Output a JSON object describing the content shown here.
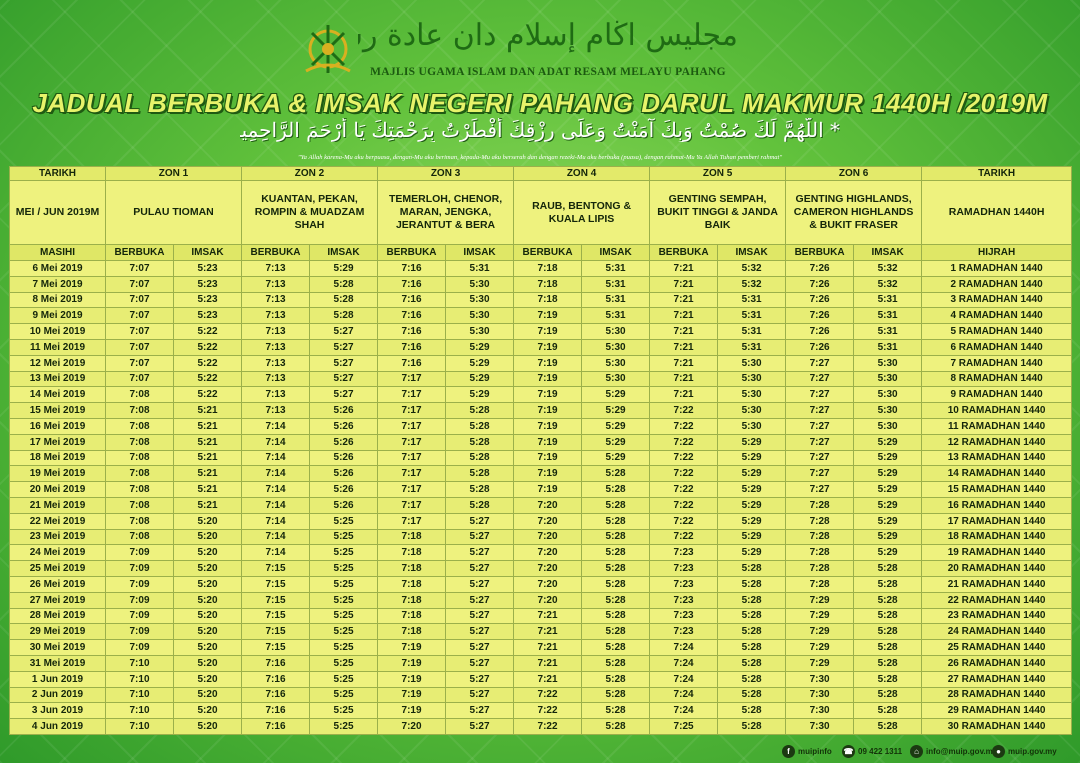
{
  "header": {
    "org_arabic": "مجليس اڬام إسلام دان عادة رسم ملايو ڤهڠ",
    "org_latin": "MAJLIS UGAMA ISLAM DAN ADAT RESAM MELAYU PAHANG",
    "main_title": "JADUAL BERBUKA & IMSAK NEGERI PAHANG DARUL MAKMUR 1440H /2019M",
    "dua_arabic": "* اللَّهُمَّ لَكَ صُمْتُ وَبِكَ آمَنْتُ وَعَلَى رِزْقِكَ أَفْطَرْتُ بِرَحْمَتِكَ يَا أَرْحَمَ الرَّاحِمِينَ *",
    "dua_translation": "\"Ya Allah karena-Mu aku berpuasa, dengan-Mu aku beriman, kepada-Mu aku berserah dan dengan rezeki-Mu aku berbuka (puasa), dengan rahmat-Mu Ya Allah Tuhan pemberi rahmat\""
  },
  "table": {
    "tarikh_label": "TARIKH",
    "tarikh_label_right": "TARIKH",
    "zones": [
      "ZON 1",
      "ZON 2",
      "ZON 3",
      "ZON 4",
      "ZON 5",
      "ZON 6"
    ],
    "month_label": "MEI / JUN 2019M",
    "zone_areas": [
      "PULAU TIOMAN",
      "KUANTAN, PEKAN, ROMPIN & MUADZAM SHAH",
      "TEMERLOH, CHENOR, MARAN, JENGKA, JERANTUT & BERA",
      "RAUB, BENTONG & KUALA LIPIS",
      "GENTING SEMPAH, BUKIT TINGGI & JANDA BAIK",
      "GENTING HIGHLANDS, CAMERON HIGHLANDS & BUKIT FRASER"
    ],
    "ramadhan_label": "RAMADHAN 1440H",
    "masihi_label": "MASIHI",
    "berbuka_label": "BERBUKA",
    "imsak_label": "IMSAK",
    "hijrah_label": "HIJRAH",
    "rows": [
      {
        "date": "6 Mei 2019",
        "t": [
          "7:07",
          "5:23",
          "7:13",
          "5:29",
          "7:16",
          "5:31",
          "7:18",
          "5:31",
          "7:21",
          "5:32",
          "7:26",
          "5:32"
        ],
        "hijri": "1 RAMADHAN 1440"
      },
      {
        "date": "7 Mei 2019",
        "t": [
          "7:07",
          "5:23",
          "7:13",
          "5:28",
          "7:16",
          "5:30",
          "7:18",
          "5:31",
          "7:21",
          "5:32",
          "7:26",
          "5:32"
        ],
        "hijri": "2 RAMADHAN 1440"
      },
      {
        "date": "8 Mei 2019",
        "t": [
          "7:07",
          "5:23",
          "7:13",
          "5:28",
          "7:16",
          "5:30",
          "7:18",
          "5:31",
          "7:21",
          "5:31",
          "7:26",
          "5:31"
        ],
        "hijri": "3 RAMADHAN 1440"
      },
      {
        "date": "9 Mei 2019",
        "t": [
          "7:07",
          "5:23",
          "7:13",
          "5:28",
          "7:16",
          "5:30",
          "7:19",
          "5:31",
          "7:21",
          "5:31",
          "7:26",
          "5:31"
        ],
        "hijri": "4 RAMADHAN 1440"
      },
      {
        "date": "10 Mei 2019",
        "t": [
          "7:07",
          "5:22",
          "7:13",
          "5:27",
          "7:16",
          "5:30",
          "7:19",
          "5:30",
          "7:21",
          "5:31",
          "7:26",
          "5:31"
        ],
        "hijri": "5 RAMADHAN 1440"
      },
      {
        "date": "11 Mei 2019",
        "t": [
          "7:07",
          "5:22",
          "7:13",
          "5:27",
          "7:16",
          "5:29",
          "7:19",
          "5:30",
          "7:21",
          "5:31",
          "7:26",
          "5:31"
        ],
        "hijri": "6 RAMADHAN 1440"
      },
      {
        "date": "12 Mei 2019",
        "t": [
          "7:07",
          "5:22",
          "7:13",
          "5:27",
          "7:16",
          "5:29",
          "7:19",
          "5:30",
          "7:21",
          "5:30",
          "7:27",
          "5:30"
        ],
        "hijri": "7 RAMADHAN 1440"
      },
      {
        "date": "13 Mei 2019",
        "t": [
          "7:07",
          "5:22",
          "7:13",
          "5:27",
          "7:17",
          "5:29",
          "7:19",
          "5:30",
          "7:21",
          "5:30",
          "7:27",
          "5:30"
        ],
        "hijri": "8 RAMADHAN 1440"
      },
      {
        "date": "14 Mei 2019",
        "t": [
          "7:08",
          "5:22",
          "7:13",
          "5:27",
          "7:17",
          "5:29",
          "7:19",
          "5:29",
          "7:21",
          "5:30",
          "7:27",
          "5:30"
        ],
        "hijri": "9 RAMADHAN 1440"
      },
      {
        "date": "15 Mei 2019",
        "t": [
          "7:08",
          "5:21",
          "7:13",
          "5:26",
          "7:17",
          "5:28",
          "7:19",
          "5:29",
          "7:22",
          "5:30",
          "7:27",
          "5:30"
        ],
        "hijri": "10 RAMADHAN 1440"
      },
      {
        "date": "16 Mei 2019",
        "t": [
          "7:08",
          "5:21",
          "7:14",
          "5:26",
          "7:17",
          "5:28",
          "7:19",
          "5:29",
          "7:22",
          "5:30",
          "7:27",
          "5:30"
        ],
        "hijri": "11 RAMADHAN 1440"
      },
      {
        "date": "17 Mei 2019",
        "t": [
          "7:08",
          "5:21",
          "7:14",
          "5:26",
          "7:17",
          "5:28",
          "7:19",
          "5:29",
          "7:22",
          "5:29",
          "7:27",
          "5:29"
        ],
        "hijri": "12 RAMADHAN 1440"
      },
      {
        "date": "18 Mei 2019",
        "t": [
          "7:08",
          "5:21",
          "7:14",
          "5:26",
          "7:17",
          "5:28",
          "7:19",
          "5:29",
          "7:22",
          "5:29",
          "7:27",
          "5:29"
        ],
        "hijri": "13 RAMADHAN 1440"
      },
      {
        "date": "19 Mei 2019",
        "t": [
          "7:08",
          "5:21",
          "7:14",
          "5:26",
          "7:17",
          "5:28",
          "7:19",
          "5:28",
          "7:22",
          "5:29",
          "7:27",
          "5:29"
        ],
        "hijri": "14 RAMADHAN 1440"
      },
      {
        "date": "20 Mei 2019",
        "t": [
          "7:08",
          "5:21",
          "7:14",
          "5:26",
          "7:17",
          "5:28",
          "7:19",
          "5:28",
          "7:22",
          "5:29",
          "7:27",
          "5:29"
        ],
        "hijri": "15 RAMADHAN 1440"
      },
      {
        "date": "21 Mei 2019",
        "t": [
          "7:08",
          "5:21",
          "7:14",
          "5:26",
          "7:17",
          "5:28",
          "7:20",
          "5:28",
          "7:22",
          "5:29",
          "7:28",
          "5:29"
        ],
        "hijri": "16 RAMADHAN 1440"
      },
      {
        "date": "22 Mei 2019",
        "t": [
          "7:08",
          "5:20",
          "7:14",
          "5:25",
          "7:17",
          "5:27",
          "7:20",
          "5:28",
          "7:22",
          "5:29",
          "7:28",
          "5:29"
        ],
        "hijri": "17 RAMADHAN 1440"
      },
      {
        "date": "23 Mei 2019",
        "t": [
          "7:08",
          "5:20",
          "7:14",
          "5:25",
          "7:18",
          "5:27",
          "7:20",
          "5:28",
          "7:22",
          "5:29",
          "7:28",
          "5:29"
        ],
        "hijri": "18 RAMADHAN 1440"
      },
      {
        "date": "24 Mei 2019",
        "t": [
          "7:09",
          "5:20",
          "7:14",
          "5:25",
          "7:18",
          "5:27",
          "7:20",
          "5:28",
          "7:23",
          "5:29",
          "7:28",
          "5:29"
        ],
        "hijri": "19 RAMADHAN 1440"
      },
      {
        "date": "25 Mei 2019",
        "t": [
          "7:09",
          "5:20",
          "7:15",
          "5:25",
          "7:18",
          "5:27",
          "7:20",
          "5:28",
          "7:23",
          "5:28",
          "7:28",
          "5:28"
        ],
        "hijri": "20 RAMADHAN 1440"
      },
      {
        "date": "26 Mei 2019",
        "t": [
          "7:09",
          "5:20",
          "7:15",
          "5:25",
          "7:18",
          "5:27",
          "7:20",
          "5:28",
          "7:23",
          "5:28",
          "7:28",
          "5:28"
        ],
        "hijri": "21 RAMADHAN 1440"
      },
      {
        "date": "27 Mei 2019",
        "t": [
          "7:09",
          "5:20",
          "7:15",
          "5:25",
          "7:18",
          "5:27",
          "7:20",
          "5:28",
          "7:23",
          "5:28",
          "7:29",
          "5:28"
        ],
        "hijri": "22 RAMADHAN 1440"
      },
      {
        "date": "28 Mei 2019",
        "t": [
          "7:09",
          "5:20",
          "7:15",
          "5:25",
          "7:18",
          "5:27",
          "7:21",
          "5:28",
          "7:23",
          "5:28",
          "7:29",
          "5:28"
        ],
        "hijri": "23 RAMADHAN 1440"
      },
      {
        "date": "29 Mei 2019",
        "t": [
          "7:09",
          "5:20",
          "7:15",
          "5:25",
          "7:18",
          "5:27",
          "7:21",
          "5:28",
          "7:23",
          "5:28",
          "7:29",
          "5:28"
        ],
        "hijri": "24 RAMADHAN 1440"
      },
      {
        "date": "30 Mei 2019",
        "t": [
          "7:09",
          "5:20",
          "7:15",
          "5:25",
          "7:19",
          "5:27",
          "7:21",
          "5:28",
          "7:24",
          "5:28",
          "7:29",
          "5:28"
        ],
        "hijri": "25 RAMADHAN 1440"
      },
      {
        "date": "31 Mei 2019",
        "t": [
          "7:10",
          "5:20",
          "7:16",
          "5:25",
          "7:19",
          "5:27",
          "7:21",
          "5:28",
          "7:24",
          "5:28",
          "7:29",
          "5:28"
        ],
        "hijri": "26 RAMADHAN 1440"
      },
      {
        "date": "1 Jun 2019",
        "t": [
          "7:10",
          "5:20",
          "7:16",
          "5:25",
          "7:19",
          "5:27",
          "7:21",
          "5:28",
          "7:24",
          "5:28",
          "7:30",
          "5:28"
        ],
        "hijri": "27 RAMADHAN 1440"
      },
      {
        "date": "2 Jun 2019",
        "t": [
          "7:10",
          "5:20",
          "7:16",
          "5:25",
          "7:19",
          "5:27",
          "7:22",
          "5:28",
          "7:24",
          "5:28",
          "7:30",
          "5:28"
        ],
        "hijri": "28 RAMADHAN 1440"
      },
      {
        "date": "3 Jun 2019",
        "t": [
          "7:10",
          "5:20",
          "7:16",
          "5:25",
          "7:19",
          "5:27",
          "7:22",
          "5:28",
          "7:24",
          "5:28",
          "7:30",
          "5:28"
        ],
        "hijri": "29 RAMADHAN 1440"
      },
      {
        "date": "4 Jun 2019",
        "t": [
          "7:10",
          "5:20",
          "7:16",
          "5:25",
          "7:20",
          "5:27",
          "7:22",
          "5:28",
          "7:25",
          "5:28",
          "7:30",
          "5:28"
        ],
        "hijri": "30 RAMADHAN 1440"
      }
    ]
  },
  "footer": {
    "facebook": "muipinfo",
    "phone": "09 422 1311",
    "email": "info@muip.gov.my",
    "web": "muip.gov.my"
  },
  "colors": {
    "background_green": "#4fb536",
    "table_yellow": "#eef27e",
    "title_yellow": "#e7f36a",
    "dark_green": "#1f5a12"
  }
}
